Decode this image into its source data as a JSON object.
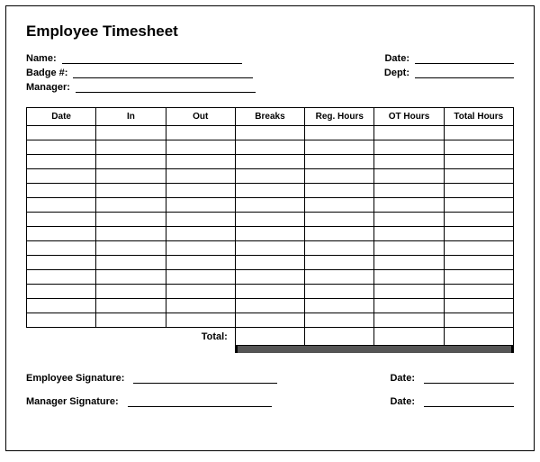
{
  "title": "Employee Timesheet",
  "meta": {
    "name_label": "Name:",
    "badge_label": "Badge #:",
    "manager_label": "Manager:",
    "date_label": "Date:",
    "dept_label": "Dept:"
  },
  "table": {
    "headers": [
      "Date",
      "In",
      "Out",
      "Breaks",
      "Reg. Hours",
      "OT Hours",
      "Total Hours"
    ],
    "row_count": 14,
    "total_label": "Total:"
  },
  "signatures": {
    "employee_label": "Employee Signature:",
    "manager_label": "Manager Signature:",
    "date_label": "Date:"
  }
}
